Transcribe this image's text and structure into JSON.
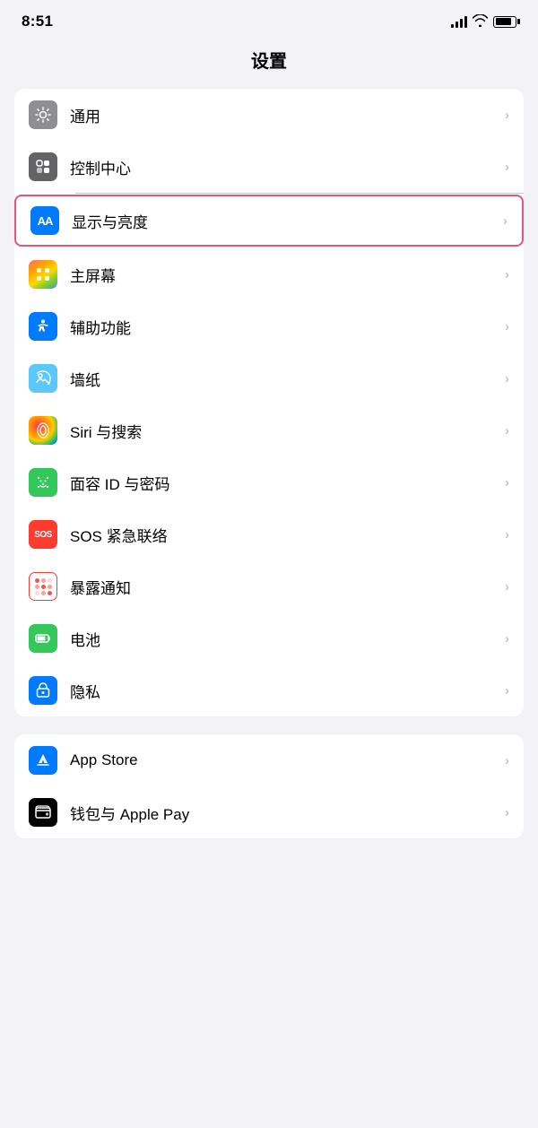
{
  "statusBar": {
    "time": "8:51"
  },
  "pageTitle": "设置",
  "sections": [
    {
      "id": "general-section",
      "items": [
        {
          "id": "general",
          "label": "通用",
          "iconBg": "icon-gray",
          "iconType": "gear",
          "highlighted": false
        },
        {
          "id": "control-center",
          "label": "控制中心",
          "iconBg": "icon-gray2",
          "iconType": "toggle",
          "highlighted": false
        },
        {
          "id": "display-brightness",
          "label": "显示与亮度",
          "iconBg": "icon-blue",
          "iconType": "aa",
          "highlighted": true
        },
        {
          "id": "home-screen",
          "label": "主屏幕",
          "iconBg": "icon-colorful",
          "iconType": "grid",
          "highlighted": false
        },
        {
          "id": "accessibility",
          "label": "辅助功能",
          "iconBg": "icon-blue-access",
          "iconType": "person",
          "highlighted": false
        },
        {
          "id": "wallpaper",
          "label": "墙纸",
          "iconBg": "icon-teal",
          "iconType": "flower",
          "highlighted": false
        },
        {
          "id": "siri",
          "label": "Siri 与搜索",
          "iconBg": "icon-siri",
          "iconType": "siri",
          "highlighted": false
        },
        {
          "id": "face-id",
          "label": "面容 ID 与密码",
          "iconBg": "icon-green-face",
          "iconType": "faceid",
          "highlighted": false
        },
        {
          "id": "sos",
          "label": "SOS 紧急联络",
          "iconBg": "icon-red-sos",
          "iconType": "sos",
          "highlighted": false
        },
        {
          "id": "exposure",
          "label": "暴露通知",
          "iconBg": "icon-exposure",
          "iconType": "exposure",
          "highlighted": false
        },
        {
          "id": "battery",
          "label": "电池",
          "iconBg": "icon-battery",
          "iconType": "battery",
          "highlighted": false
        },
        {
          "id": "privacy",
          "label": "隐私",
          "iconBg": "icon-privacy",
          "iconType": "hand",
          "highlighted": false
        }
      ]
    },
    {
      "id": "store-section",
      "items": [
        {
          "id": "app-store",
          "label": "App Store",
          "iconBg": "icon-appstore",
          "iconType": "appstore",
          "highlighted": false
        },
        {
          "id": "wallet",
          "label": "钱包与 Apple Pay",
          "iconBg": "icon-wallet",
          "iconType": "wallet",
          "highlighted": false
        }
      ]
    }
  ]
}
